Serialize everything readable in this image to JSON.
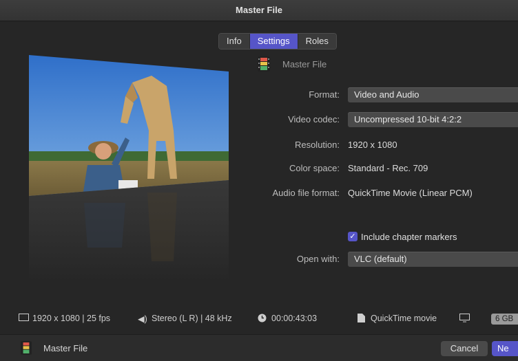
{
  "window": {
    "title": "Master File"
  },
  "tabs": [
    {
      "label": "Info",
      "active": false
    },
    {
      "label": "Settings",
      "active": true
    },
    {
      "label": "Roles",
      "active": false
    }
  ],
  "preset": {
    "icon": "film-strip-icon",
    "name": "Master File"
  },
  "settings": {
    "format": {
      "label": "Format:",
      "value": "Video and Audio"
    },
    "video_codec": {
      "label": "Video codec:",
      "value": "Uncompressed 10-bit 4:2:2"
    },
    "resolution": {
      "label": "Resolution:",
      "value": "1920 x 1080"
    },
    "color_space": {
      "label": "Color space:",
      "value": "Standard - Rec. 709"
    },
    "audio_format": {
      "label": "Audio file format:",
      "value": "QuickTime Movie (Linear PCM)"
    },
    "chapter_markers": {
      "label": "Include chapter markers",
      "checked": true
    },
    "open_with": {
      "label": "Open with:",
      "value": "VLC (default)"
    }
  },
  "summary": {
    "video": "1920 x 1080 | 25 fps",
    "audio": "Stereo (L R) | 48 kHz",
    "duration": "00:00:43:03",
    "file_type": "QuickTime movie",
    "size": "6 GB"
  },
  "footer": {
    "preset_name": "Master File",
    "cancel_label": "Cancel",
    "next_label": "Ne"
  },
  "colors": {
    "accent": "#5655c8",
    "background": "#262626"
  }
}
